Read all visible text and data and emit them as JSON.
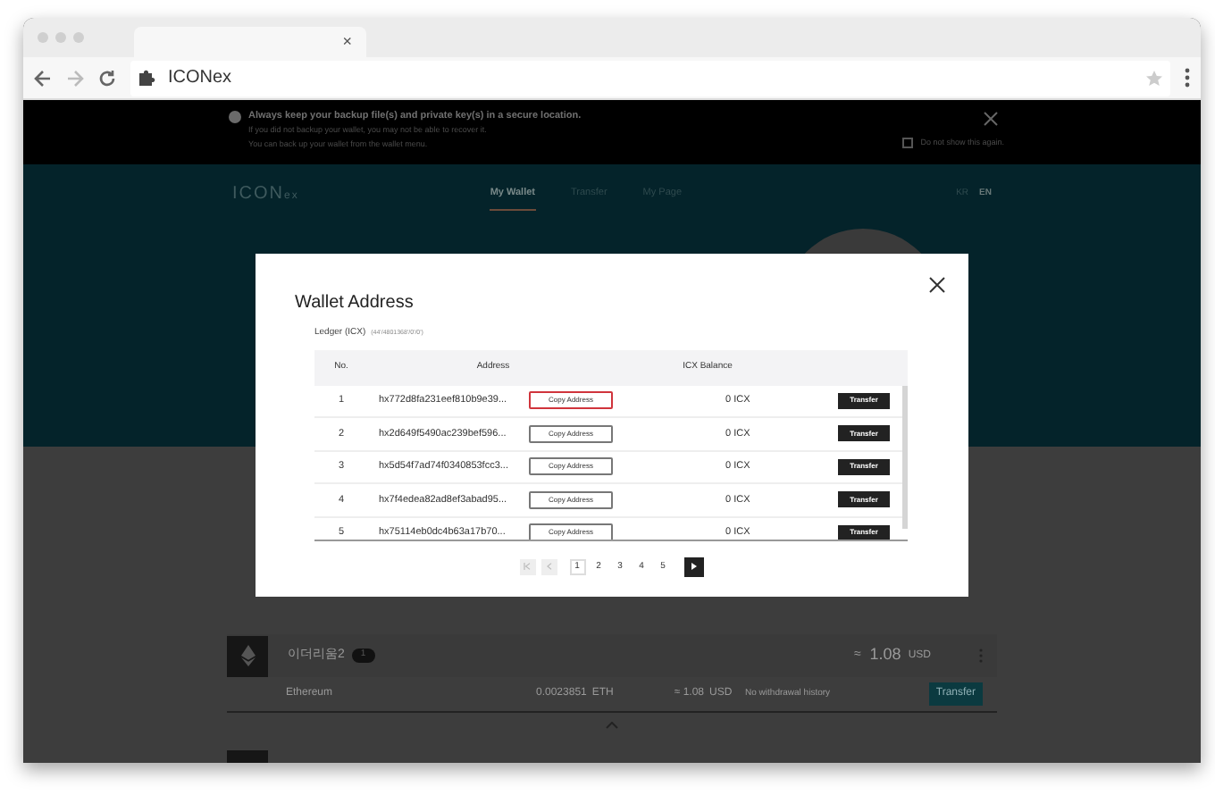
{
  "browser": {
    "tab_close": "×",
    "address": "ICONex"
  },
  "banner": {
    "title": "Always keep your backup file(s) and private key(s) in a secure location.",
    "lines": [
      "If you did not backup your wallet, you may not be able to recover it.",
      "You can back up your wallet from the wallet menu."
    ],
    "dont_show": {
      "label": "Do not show this again.",
      "checked": false
    }
  },
  "header": {
    "logo": "ICON",
    "logo_suffix": "ex",
    "nav": [
      {
        "label": "My Wallet",
        "selected": true
      },
      {
        "label": "Transfer",
        "selected": false
      },
      {
        "label": "My Page",
        "selected": false
      }
    ],
    "languages": [
      {
        "label": "KR",
        "selected": false
      },
      {
        "label": "EN",
        "selected": true
      }
    ]
  },
  "wallet": {
    "name": "이더리움2",
    "count": "1",
    "approx": "≈",
    "total": "1.08",
    "total_unit": "USD",
    "token": {
      "name": "Ethereum",
      "amount": "0.0023851",
      "unit": "ETH",
      "value": "≈ 1.08",
      "value_unit": "USD",
      "history": "No withdrawal history",
      "action": "Transfer"
    }
  },
  "modal": {
    "title": "Wallet Address",
    "source": "Ledger (ICX)",
    "path": "(44'/4801368'/0'/0')",
    "columns": [
      "No.",
      "Address",
      "ICX Balance"
    ],
    "rows": [
      {
        "no": "1",
        "address": "hx772d8fa231eef810b9e39...",
        "copy": "Copy Address",
        "highlighted": true,
        "balance": "0 ICX",
        "action": "Transfer"
      },
      {
        "no": "2",
        "address": "hx2d649f5490ac239bef596...",
        "copy": "Copy Address",
        "highlighted": false,
        "balance": "0 ICX",
        "action": "Transfer"
      },
      {
        "no": "3",
        "address": "hx5d54f7ad74f0340853fcc3...",
        "copy": "Copy Address",
        "highlighted": false,
        "balance": "0 ICX",
        "action": "Transfer"
      },
      {
        "no": "4",
        "address": "hx7f4edea82ad8ef3abad95...",
        "copy": "Copy Address",
        "highlighted": false,
        "balance": "0 ICX",
        "action": "Transfer"
      },
      {
        "no": "5",
        "address": "hx75114eb0dc4b63a17b70...",
        "copy": "Copy Address",
        "highlighted": false,
        "balance": "0 ICX",
        "action": "Transfer"
      }
    ],
    "pages": [
      {
        "label": "1",
        "selected": true
      },
      {
        "label": "2",
        "selected": false
      },
      {
        "label": "3",
        "selected": false
      },
      {
        "label": "4",
        "selected": false
      },
      {
        "label": "5",
        "selected": false
      }
    ]
  }
}
